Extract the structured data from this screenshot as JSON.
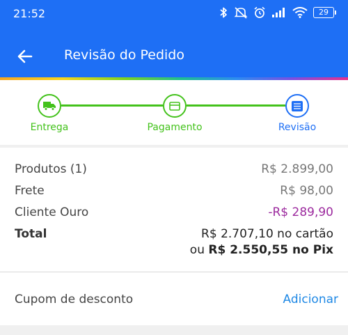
{
  "status_bar": {
    "time": "21:52",
    "battery": "29"
  },
  "header": {
    "title": "Revisão do Pedido"
  },
  "steps": [
    {
      "label": "Entrega",
      "icon": "truck-icon",
      "state": "done",
      "color": "#43c21b"
    },
    {
      "label": "Pagamento",
      "icon": "card-icon",
      "state": "done",
      "color": "#43c21b"
    },
    {
      "label": "Revisão",
      "icon": "list-icon",
      "state": "current",
      "color": "#1e6ff5"
    }
  ],
  "summary": {
    "products_label": "Produtos (1)",
    "products_value": "R$ 2.899,00",
    "shipping_label": "Frete",
    "shipping_value": "R$ 98,00",
    "discount_label": "Cliente Ouro",
    "discount_value": "-R$ 289,90",
    "total_label": "Total",
    "total_card": "R$ 2.707,10 no cartão",
    "total_pix_prefix": "ou",
    "total_pix_value": "R$ 2.550,55 no Pix"
  },
  "coupon": {
    "label": "Cupom de desconto",
    "action": "Adicionar"
  },
  "colors": {
    "primary": "#1e6ff5",
    "success": "#43c21b",
    "discount": "#9c2a9e",
    "link": "#1e88e5"
  }
}
